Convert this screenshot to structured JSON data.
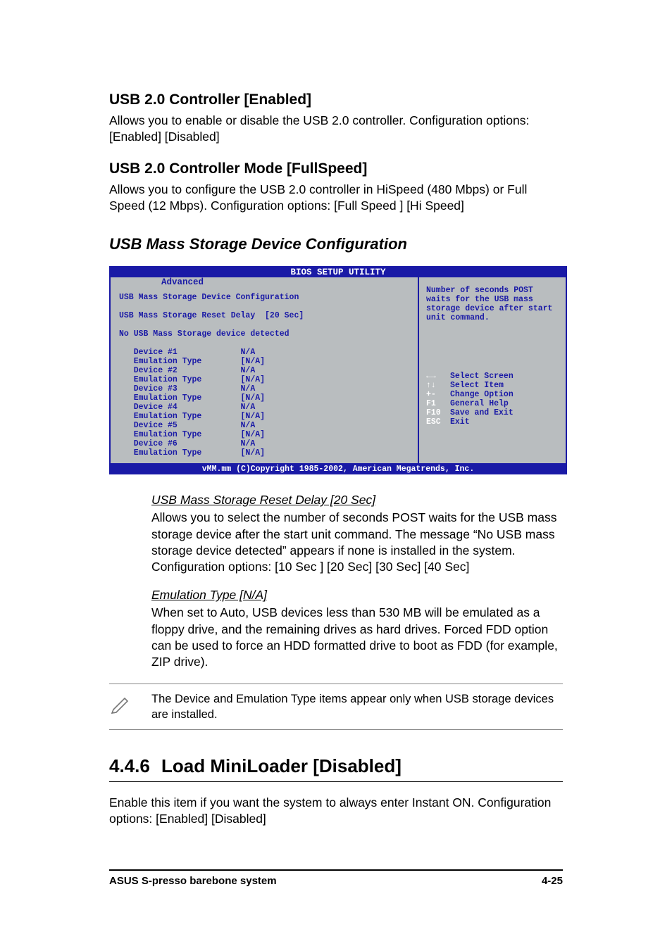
{
  "section1": {
    "title": "USB 2.0 Controller [Enabled]",
    "para": "Allows you to enable or disable the USB 2.0 controller. Configuration options: [Enabled] [Disabled]"
  },
  "section2": {
    "title": "USB 2.0 Controller Mode [FullSpeed]",
    "para": "Allows you to configure the USB 2.0 controller in HiSpeed (480 Mbps) or Full Speed (12 Mbps). Configuration options: [Full Speed ] [Hi Speed]"
  },
  "sectionHeading": "USB Mass Storage Device Configuration",
  "bios": {
    "title": "BIOS SETUP UTILITY",
    "tab": "Advanced",
    "mainHeader": "USB Mass Storage Device Configuration",
    "resetLabel": "USB Mass Storage Reset Delay",
    "resetValue": "[20 Sec]",
    "noDevice": "No USB Mass Storage device detected",
    "devices": [
      {
        "label": "Device #1",
        "val": "N/A"
      },
      {
        "label": "Emulation Type",
        "val": "[N/A]"
      },
      {
        "label": "Device #2",
        "val": "N/A"
      },
      {
        "label": "Emulation Type",
        "val": "[N/A]"
      },
      {
        "label": "Device #3",
        "val": "N/A"
      },
      {
        "label": "Emulation Type",
        "val": "[N/A]"
      },
      {
        "label": "Device #4",
        "val": "N/A"
      },
      {
        "label": "Emulation Type",
        "val": "[N/A]"
      },
      {
        "label": "Device #5",
        "val": "N/A"
      },
      {
        "label": "Emulation Type",
        "val": "[N/A]"
      },
      {
        "label": "Device #6",
        "val": "N/A"
      },
      {
        "label": "Emulation Type",
        "val": "[N/A]"
      }
    ],
    "help": "Number of seconds POST waits for the USB mass storage device after start unit command.",
    "keys": [
      {
        "k": "←→",
        "d": "Select Screen"
      },
      {
        "k": "↑↓",
        "d": "Select Item"
      },
      {
        "k": "+-",
        "d": "Change Option"
      },
      {
        "k": "F1",
        "d": "General Help"
      },
      {
        "k": "F10",
        "d": "Save and Exit"
      },
      {
        "k": "ESC",
        "d": "Exit"
      }
    ],
    "footer": "vMM.mm (C)Copyright 1985-2002, American Megatrends, Inc."
  },
  "sub1": {
    "title": "USB Mass Storage Reset Delay [20 Sec]",
    "para": "Allows you to select the number of seconds POST waits for the USB mass storage device after the start unit command. The message “No USB mass storage device detected” appears if none is installed in the system. Configuration options: [10 Sec ] [20 Sec] [30 Sec] [40 Sec]"
  },
  "sub2": {
    "title": "Emulation Type [N/A]",
    "para": "When set to Auto, USB devices less than 530 MB will be emulated as a floppy drive, and the remaining drives as hard drives. Forced FDD option can be used to force an HDD formatted drive to boot as FDD (for example, ZIP drive)."
  },
  "note": "The Device and Emulation Type items appear only when USB storage devices are installed.",
  "section446": {
    "num": "4.4.6",
    "title": "Load MiniLoader [Disabled]",
    "para": "Enable this item if you want the system to always enter Instant ON. Configuration options: [Enabled] [Disabled]"
  },
  "footer": {
    "left": "ASUS S-presso barebone system",
    "right": "4-25"
  }
}
